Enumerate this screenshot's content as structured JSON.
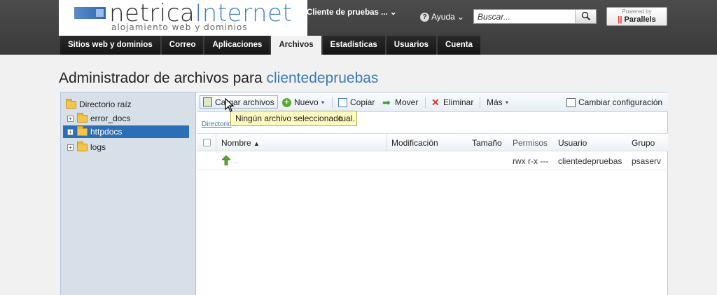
{
  "header": {
    "brand_dark": "netrica",
    "brand_blue": "Internet",
    "tagline": "alojamiento web y dominios",
    "client_label": "Cliente de pruebas ...",
    "help_label": "Ayuda",
    "search_placeholder": "Buscar...",
    "powered_by": "Powered by",
    "powered_brand": "Parallels"
  },
  "tabs": [
    {
      "label": "Sitios web y dominios"
    },
    {
      "label": "Correo"
    },
    {
      "label": "Aplicaciones"
    },
    {
      "label": "Archivos",
      "active": true
    },
    {
      "label": "Estadísticas"
    },
    {
      "label": "Usuarios"
    },
    {
      "label": "Cuenta"
    }
  ],
  "page": {
    "title_prefix": "Administrador de archivos para",
    "account": "clientedepruebas"
  },
  "tree": {
    "root": "Directorio raíz",
    "items": [
      {
        "label": "error_docs"
      },
      {
        "label": "httpdocs",
        "selected": true
      },
      {
        "label": "logs"
      }
    ]
  },
  "toolbar": {
    "upload": "Cargar archivos",
    "new": "Nuevo",
    "copy": "Copiar",
    "move": "Mover",
    "delete": "Eliminar",
    "more": "Más",
    "settings": "Cambiar configuración"
  },
  "breadcrumb": "Directorio",
  "tooltip": {
    "text": "Ningún archivo seleccionado",
    "tail": "tual."
  },
  "table": {
    "columns": {
      "name": "Nombre",
      "modified": "Modificación",
      "size": "Tamaño",
      "permissions": "Permisos",
      "user": "Usuario",
      "group": "Grupo"
    },
    "rows": [
      {
        "name": "..",
        "permissions": "rwx r-x ---",
        "user": "clientedepruebas",
        "group": "psaserv"
      }
    ]
  },
  "colors": {
    "accent": "#3c79b8",
    "selected": "#2d6fb6",
    "header_bg": "#3a3a3a",
    "tooltip_bg": "#fdfbbf"
  }
}
